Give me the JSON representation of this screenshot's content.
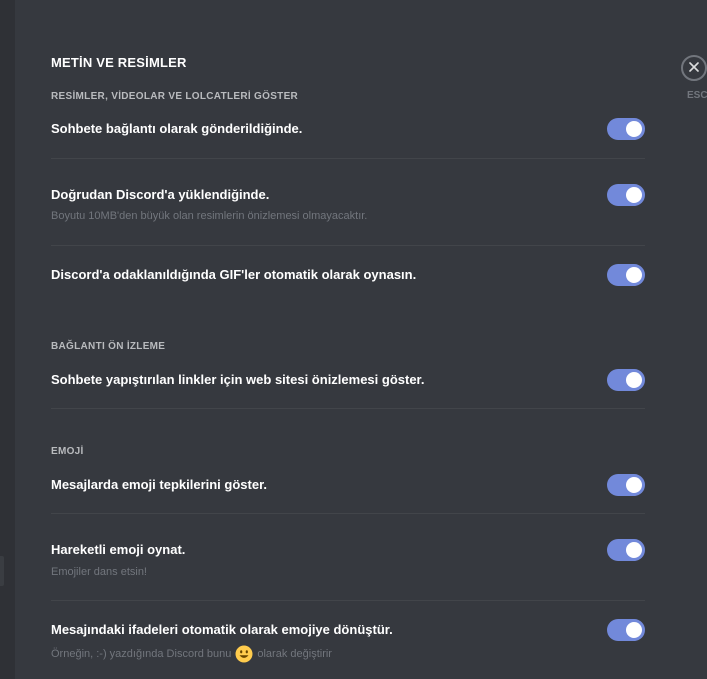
{
  "page": {
    "title": "METİN VE RESİMLER",
    "close_label": "ESC"
  },
  "sections": [
    {
      "header": "RESİMLER, VİDEOLAR VE LOLCATLERİ GÖSTER",
      "items": [
        {
          "label": "Sohbete bağlantı olarak gönderildiğinde.",
          "enabled": true
        },
        {
          "label": "Doğrudan Discord'a yüklendiğinde.",
          "note": "Boyutu 10MB'den büyük olan resimlerin önizlemesi olmayacaktır.",
          "enabled": true
        },
        {
          "label": "Discord'a odaklanıldığında GIF'ler otomatik olarak oynasın.",
          "enabled": true
        }
      ]
    },
    {
      "header": "BAĞLANTI ÖN İZLEME",
      "items": [
        {
          "label": "Sohbete yapıştırılan linkler için web sitesi önizlemesi göster.",
          "enabled": true
        }
      ]
    },
    {
      "header": "EMOJİ",
      "items": [
        {
          "label": "Mesajlarda emoji tepkilerini göster.",
          "enabled": true
        },
        {
          "label": "Hareketli emoji oynat.",
          "note": "Emojiler dans etsin!",
          "enabled": true
        },
        {
          "label": "Mesajındaki ifadeleri otomatik olarak emojiye dönüştür.",
          "note_before": "Örneğin, :-) yazdığında Discord bunu",
          "note_after": "olarak değiştirir",
          "note_emoji": "smiley-emoji",
          "enabled": true
        }
      ]
    }
  ],
  "colors": {
    "background": "#36393f",
    "toggle_on": "#7289da",
    "text_primary": "#ffffff",
    "text_header": "#b9bbbe",
    "text_muted": "#72767d"
  }
}
